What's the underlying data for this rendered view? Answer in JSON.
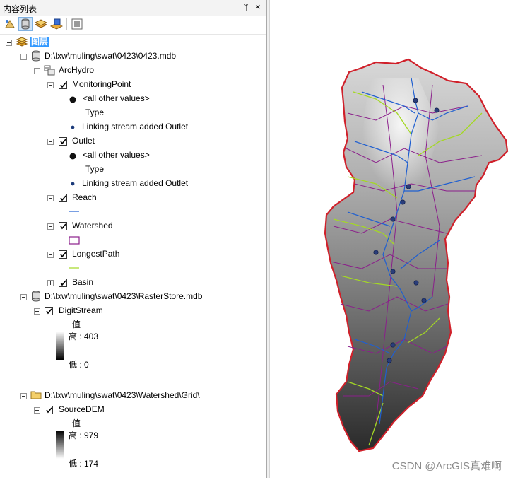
{
  "panel": {
    "title": "内容列表",
    "pin_glyph": "ᛘ",
    "close_glyph": "×"
  },
  "toolbar": {
    "buttons": [
      "list-by-drawing-order-icon",
      "list-by-source-icon",
      "list-by-visibility-icon",
      "list-by-selection-icon",
      "options-icon"
    ]
  },
  "tree": {
    "root_label": "图层",
    "db1": {
      "path": "D:\\lxw\\muling\\swat\\0423\\0423.mdb",
      "dataset": "ArcHydro",
      "monitoring_point": {
        "label": "MonitoringPoint",
        "all_other": "<all other values>",
        "type_heading": "Type",
        "value_label": "Linking stream added Outlet"
      },
      "outlet": {
        "label": "Outlet",
        "all_other": "<all other values>",
        "type_heading": "Type",
        "value_label": "Linking stream added Outlet"
      },
      "reach": "Reach",
      "watershed": "Watershed",
      "longest_path": "LongestPath",
      "basin": "Basin"
    },
    "db2": {
      "path": "D:\\lxw\\muling\\swat\\0423\\RasterStore.mdb",
      "layer": "DigitStream",
      "value_heading": "值",
      "high_label": "高 : 403",
      "low_label": "低 : 0"
    },
    "folder": {
      "path": "D:\\lxw\\muling\\swat\\0423\\Watershed\\Grid\\",
      "layer": "SourceDEM",
      "value_heading": "值",
      "high_label": "高 : 979",
      "low_label": "低 : 174"
    }
  },
  "colors": {
    "reach": "#1f5fd0",
    "watershed": "#8b1f8b",
    "longest_path": "#a4d824",
    "basin_outline": "#d0202a",
    "selection": "#3399ff"
  },
  "watermark": "CSDN @ArcGIS真难啊"
}
